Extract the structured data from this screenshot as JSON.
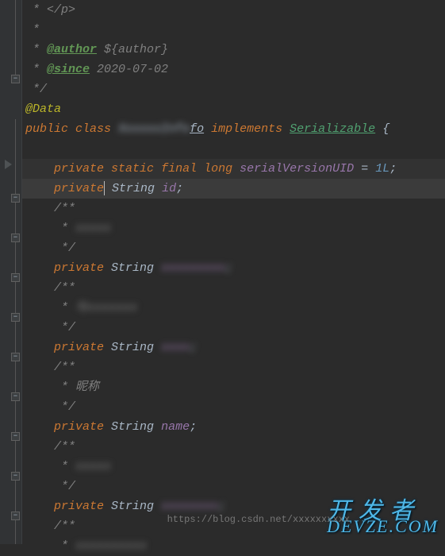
{
  "javadoc": {
    "closeP": " * </p>",
    "empty": " *",
    "authorTag": "@author",
    "authorVal": "${author}",
    "sinceTag": "@since",
    "sinceVal": "2020-07-02",
    "end": " */"
  },
  "annotation": "@Data",
  "classDecl": {
    "kwPublic": "public",
    "kwClass": "class",
    "nameObf": "XxxxxxInfo",
    "nameVis": "fo",
    "kwImpl": "implements",
    "iface": "Serializable",
    "brace": "{"
  },
  "svu": {
    "kwPrivate": "private",
    "kwStatic": "static",
    "kwFinal": "final",
    "kwLong": "long",
    "name": "serialVersionUID",
    "eq": "=",
    "val": "1L",
    "semi": ";"
  },
  "fields": [
    {
      "type": "String",
      "name": "id",
      "obf": false,
      "comment": null
    },
    {
      "type": "String",
      "name": "xxxxxxxxx",
      "obf": true,
      "comment": "xxxxx"
    },
    {
      "type": "String",
      "name": "xxxx",
      "obf": true,
      "comment": "与xxxxxxx"
    },
    {
      "type": "String",
      "name": "name",
      "obf": false,
      "comment": "昵称"
    },
    {
      "type": "String",
      "name": "xxxxxxxx",
      "obf": true,
      "comment": "xxxxx"
    }
  ],
  "commentTail": "xxxxxxxxxx",
  "kw": {
    "priv": "private"
  },
  "docOpen": "/**",
  "docStar": " * ",
  "docEnd": " */",
  "watermark": {
    "big": "开 发 者",
    "dom": "DEVZE.COM",
    "url": "https://blog.csdn.net/xxxxxxxxxx"
  }
}
